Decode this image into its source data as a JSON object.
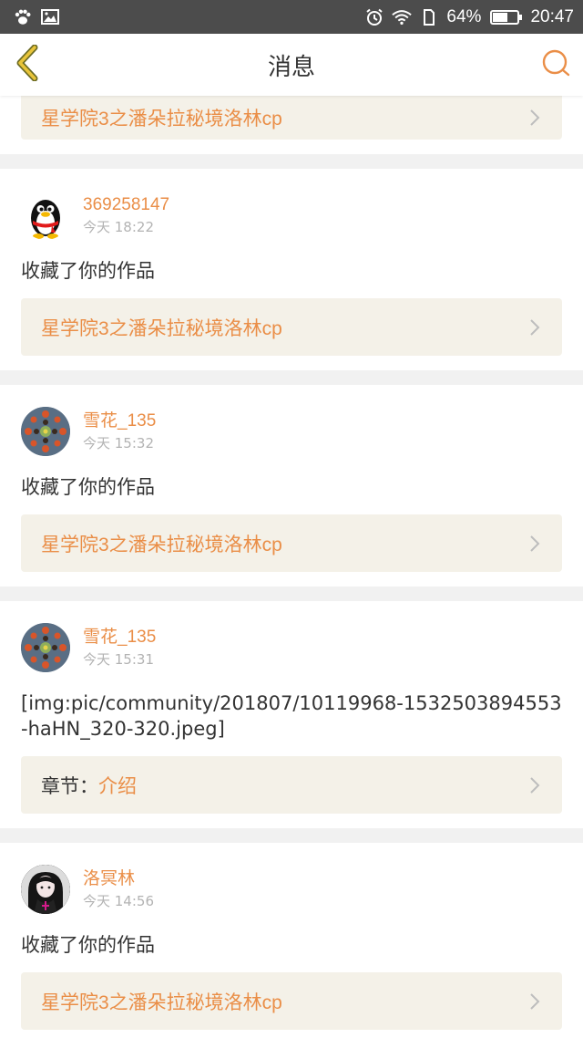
{
  "status_bar": {
    "battery_percent": "64%",
    "battery_level": 0.64,
    "time": "20:47",
    "icons": [
      "paw-icon",
      "image-icon",
      "alarm-icon",
      "wifi-icon",
      "sim-icon",
      "battery-icon"
    ]
  },
  "nav": {
    "title": "消息",
    "back_icon": "chevron-left-icon",
    "search_icon": "search-icon",
    "accent": "#ea8e47"
  },
  "first_card": {
    "work_title": "星学院3之潘朵拉秘境洛林cp"
  },
  "messages": [
    {
      "user": "369258147",
      "time": "今天 18:22",
      "avatar": "penguin-avatar",
      "text": "收藏了你的作品",
      "work_title": "星学院3之潘朵拉秘境洛林cp"
    },
    {
      "user": "雪花_135",
      "time": "今天 15:32",
      "avatar": "kaleidoscope-avatar",
      "text": "收藏了你的作品",
      "work_title": "星学院3之潘朵拉秘境洛林cp"
    },
    {
      "user": "雪花_135",
      "time": "今天 15:31",
      "avatar": "kaleidoscope-avatar",
      "text": "[img:pic/community/201807/10119968-1532503894553-haHN_320-320.jpeg]",
      "chapter_label": "章节：",
      "chapter_name": "介绍"
    },
    {
      "user": "洛冥林",
      "time": "今天 14:56",
      "avatar": "anime-girl-avatar",
      "text": "收藏了你的作品",
      "work_title": "星学院3之潘朵拉秘境洛林cp"
    }
  ]
}
